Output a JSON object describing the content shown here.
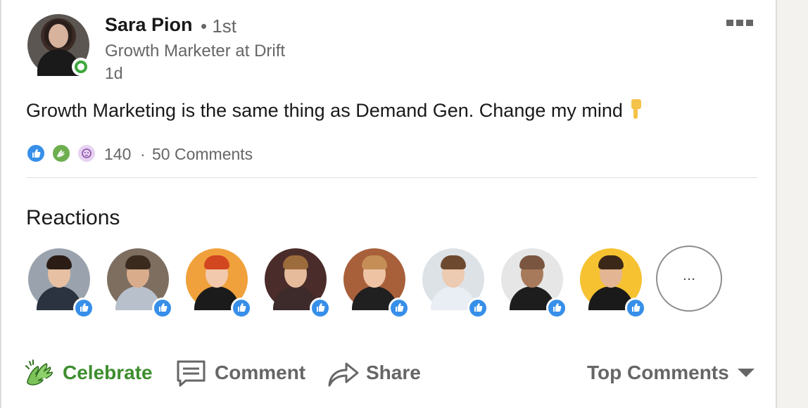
{
  "post": {
    "author": {
      "name": "Sara Pion",
      "degree": "• 1st",
      "headline": "Growth Marketer at Drift",
      "timestamp": "1d",
      "online": true
    },
    "text": "Growth Marketing is the same thing as Demand Gen. Change my mind",
    "emoji": "backhand-index-pointing-down",
    "reaction_types": [
      "like",
      "celebrate",
      "curious"
    ],
    "reaction_count": "140",
    "separator": "·",
    "comment_count": "50 Comments"
  },
  "reactions": {
    "title": "Reactions",
    "people": [
      {
        "reaction": "like",
        "skin": "#e7c0a4",
        "hair": "#2b1d16",
        "shirt": "#2b3340",
        "bg": "#9aa3ad"
      },
      {
        "reaction": "like",
        "skin": "#d9ad8c",
        "hair": "#3a2a1e",
        "shirt": "#b8c0cc",
        "bg": "#7d6e60"
      },
      {
        "reaction": "like",
        "skin": "#f2c9ad",
        "hair": "#d2471f",
        "shirt": "#1b1b1b",
        "bg": "#f0a13c"
      },
      {
        "reaction": "like",
        "skin": "#e6bb9c",
        "hair": "#9c6c3c",
        "shirt": "#3d2b2b",
        "bg": "#4a2c2a"
      },
      {
        "reaction": "like",
        "skin": "#eec3a4",
        "hair": "#c48e56",
        "shirt": "#202020",
        "bg": "#a8603a"
      },
      {
        "reaction": "like",
        "skin": "#eccbb2",
        "hair": "#6d4a2f",
        "shirt": "#e9eef4",
        "bg": "#dde2e6"
      },
      {
        "reaction": "like",
        "skin": "#a77a5c",
        "hair": "#7a5640",
        "shirt": "#1d1d1d",
        "bg": "#e6e6e6"
      },
      {
        "reaction": "like",
        "skin": "#e4b592",
        "hair": "#3c2819",
        "shirt": "#1a1a1a",
        "bg": "#f6c232"
      }
    ],
    "more_label": "..."
  },
  "actions": {
    "celebrate_label": "Celebrate",
    "comment_label": "Comment",
    "share_label": "Share",
    "sort_label": "Top Comments"
  },
  "colors": {
    "celebrate_green": "#3e8e2f",
    "like_blue": "#378fe9",
    "online_green": "#3ca83c",
    "muted_text": "#666666"
  }
}
